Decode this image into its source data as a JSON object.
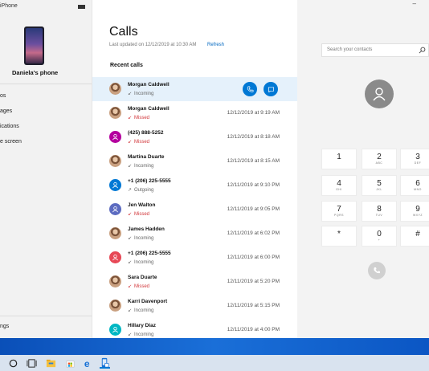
{
  "nav": {
    "device_label": "iPhone",
    "phone_name": "Daniela's phone",
    "items": [
      {
        "label": "os"
      },
      {
        "label": "ages"
      },
      {
        "label": "ications"
      },
      {
        "label": "e screen"
      }
    ],
    "settings_label": "ngs"
  },
  "calls": {
    "title": "Calls",
    "last_updated": "Last updated on 12/12/2019 at 10:30 AM",
    "refresh_label": "Refresh",
    "recent_label": "Recent calls",
    "rows": [
      {
        "name": "Morgan Caldwell",
        "status": "Incoming",
        "type": "incoming",
        "time": "",
        "avatar": "photo",
        "selected": true
      },
      {
        "name": "Morgan Caldwell",
        "status": "Missed",
        "type": "missed",
        "time": "12/12/2019 at 9:19 AM",
        "avatar": "photo"
      },
      {
        "name": "(425) 888-5252",
        "status": "Missed",
        "type": "missed",
        "time": "12/12/2019 at 8:18 AM",
        "avatar": "initial",
        "avatar_color": "#b4009e"
      },
      {
        "name": "Martina Duarte",
        "status": "Incoming",
        "type": "incoming",
        "time": "12/12/2019 at 8:15 AM",
        "avatar": "photo"
      },
      {
        "name": "+1 (206) 225-5555",
        "status": "Outgoing",
        "type": "outgoing",
        "time": "12/11/2019 at 9:10 PM",
        "avatar": "initial",
        "avatar_color": "#0078d4"
      },
      {
        "name": "Jen Walton",
        "status": "Missed",
        "type": "missed",
        "time": "12/11/2019 at 9:05 PM",
        "avatar": "initial",
        "avatar_color": "#5c6bc0"
      },
      {
        "name": "James Hadden",
        "status": "Incoming",
        "type": "incoming",
        "time": "12/11/2019 at 6:02 PM",
        "avatar": "photo"
      },
      {
        "name": "+1 (206) 225-5555",
        "status": "Incoming",
        "type": "incoming",
        "time": "12/11/2019 at 6:00 PM",
        "avatar": "initial",
        "avatar_color": "#e74856"
      },
      {
        "name": "Sara Duarte",
        "status": "Missed",
        "type": "missed",
        "time": "12/11/2019 at 5:20 PM",
        "avatar": "photo"
      },
      {
        "name": "Karri Davenport",
        "status": "Incoming",
        "type": "incoming",
        "time": "12/11/2019 at 5:15 PM",
        "avatar": "photo"
      },
      {
        "name": "Hillary Diaz",
        "status": "Incoming",
        "type": "incoming",
        "time": "12/11/2019 at 4:00 PM",
        "avatar": "initial",
        "avatar_color": "#00b7c3"
      }
    ]
  },
  "dialer": {
    "minimize_label": "–",
    "search_placeholder": "Search your contacts",
    "keys": [
      {
        "digit": "1",
        "letters": ""
      },
      {
        "digit": "2",
        "letters": "ABC"
      },
      {
        "digit": "3",
        "letters": "DEF"
      },
      {
        "digit": "4",
        "letters": "GHI"
      },
      {
        "digit": "5",
        "letters": "JKL"
      },
      {
        "digit": "6",
        "letters": "MNO"
      },
      {
        "digit": "7",
        "letters": "PQRS"
      },
      {
        "digit": "8",
        "letters": "TUV"
      },
      {
        "digit": "9",
        "letters": "WXYZ"
      },
      {
        "digit": "*",
        "letters": ""
      },
      {
        "digit": "0",
        "letters": "+"
      },
      {
        "digit": "#",
        "letters": ""
      }
    ]
  },
  "colors": {
    "accent": "#0078d4",
    "missed": "#d13438",
    "selected_row": "#e5f1fb"
  },
  "taskbar": {
    "icons": [
      "search-circle-icon",
      "task-view-icon",
      "file-explorer-icon",
      "store-icon",
      "edge-icon",
      "your-phone-icon"
    ]
  }
}
